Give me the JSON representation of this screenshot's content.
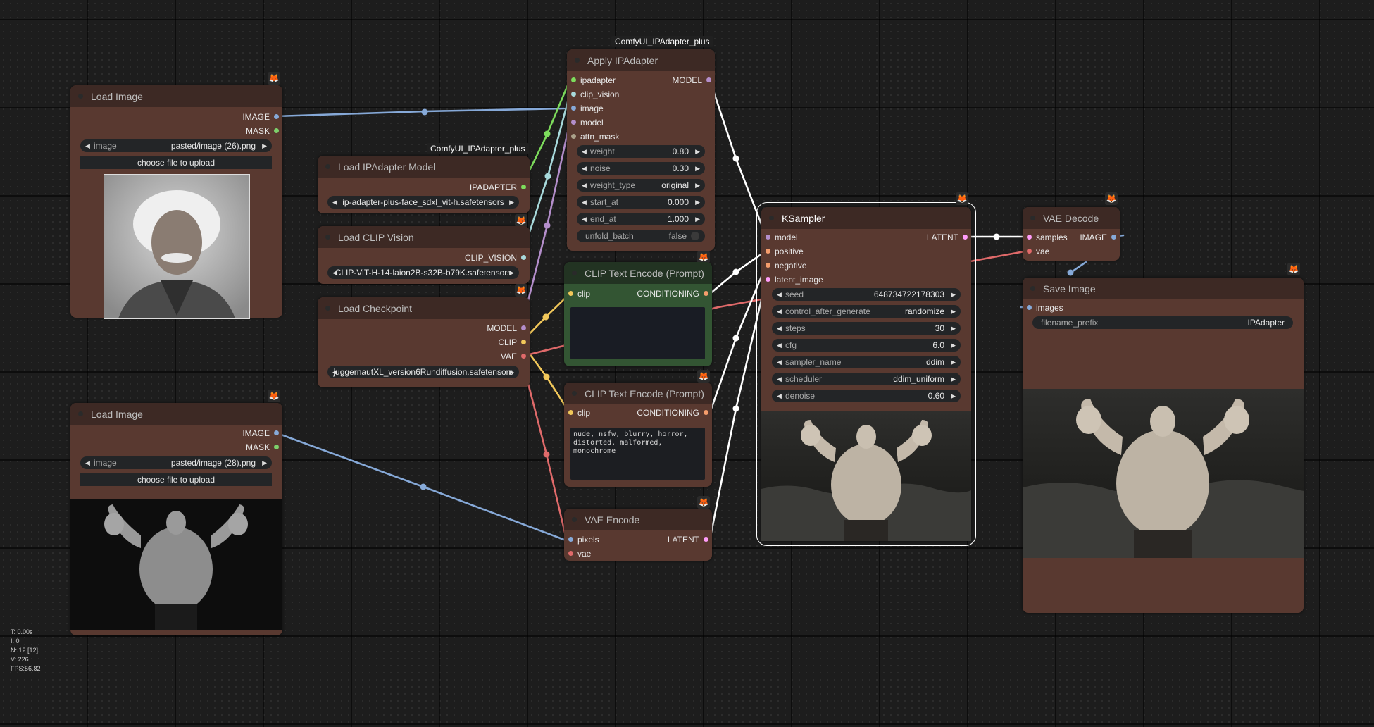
{
  "colors": {
    "model": "#b48ecb",
    "clip": "#f2c85a",
    "vae": "#e06a6a",
    "image": "#86a9d8",
    "mask": "#7dd06b",
    "latent": "#ff9cf9",
    "conditioning": "#f59d6c",
    "clip_vision": "#a8dadc",
    "ipadapter": "#7ddc5c",
    "white": "#ffffff"
  },
  "nodes": {
    "load_image_1": {
      "title": "Load Image",
      "outputs": [
        "IMAGE",
        "MASK"
      ],
      "widget_label": "image",
      "widget_value": "pasted/image (26).png",
      "button": "choose file to upload",
      "preview_alt": "portrait photo"
    },
    "load_image_2": {
      "title": "Load Image",
      "outputs": [
        "IMAGE",
        "MASK"
      ],
      "widget_label": "image",
      "widget_value": "pasted/image (28).png",
      "button": "choose file to upload",
      "preview_alt": "bodybuilder photo"
    },
    "ipadapter_model": {
      "title": "Load IPAdapter Model",
      "pack": "ComfyUI_IPAdapter_plus",
      "output": "IPADAPTER",
      "widget_value": "ip-adapter-plus-face_sdxl_vit-h.safetensors"
    },
    "clip_vision": {
      "title": "Load CLIP Vision",
      "output": "CLIP_VISION",
      "widget_value": "CLIP-ViT-H-14-laion2B-s32B-b79K.safetensors"
    },
    "checkpoint": {
      "title": "Load Checkpoint",
      "outputs": [
        "MODEL",
        "CLIP",
        "VAE"
      ],
      "widget_value": "juggernautXL_version6Rundiffusion.safetensors"
    },
    "apply_ipadapter": {
      "title": "Apply IPAdapter",
      "pack": "ComfyUI_IPAdapter_plus",
      "inputs": [
        "ipadapter",
        "clip_vision",
        "image",
        "model",
        "attn_mask"
      ],
      "output": "MODEL",
      "widgets": [
        {
          "label": "weight",
          "value": "0.80"
        },
        {
          "label": "noise",
          "value": "0.30"
        },
        {
          "label": "weight_type",
          "value": "original"
        },
        {
          "label": "start_at",
          "value": "0.000"
        },
        {
          "label": "end_at",
          "value": "1.000"
        }
      ],
      "toggle": {
        "label": "unfold_batch",
        "value": "false"
      }
    },
    "clip_text_pos": {
      "title": "CLIP Text Encode (Prompt)",
      "input": "clip",
      "output": "CONDITIONING",
      "text": ""
    },
    "clip_text_neg": {
      "title": "CLIP Text Encode (Prompt)",
      "input": "clip",
      "output": "CONDITIONING",
      "text": "nude, nsfw, blurry, horror,\ndistorted, malformed,\nmonochrome"
    },
    "vae_encode": {
      "title": "VAE Encode",
      "inputs": [
        "pixels",
        "vae"
      ],
      "output": "LATENT"
    },
    "ksampler": {
      "title": "KSampler",
      "inputs": [
        "model",
        "positive",
        "negative",
        "latent_image"
      ],
      "output": "LATENT",
      "widgets": [
        {
          "label": "seed",
          "value": "648734722178303"
        },
        {
          "label": "control_after_generate",
          "value": "randomize"
        },
        {
          "label": "steps",
          "value": "30"
        },
        {
          "label": "cfg",
          "value": "6.0"
        },
        {
          "label": "sampler_name",
          "value": "ddim"
        },
        {
          "label": "scheduler",
          "value": "ddim_uniform"
        },
        {
          "label": "denoise",
          "value": "0.60"
        }
      ]
    },
    "vae_decode": {
      "title": "VAE Decode",
      "inputs": [
        "samples",
        "vae"
      ],
      "output": "IMAGE"
    },
    "save_image": {
      "title": "Save Image",
      "input": "images",
      "widget_label": "filename_prefix",
      "widget_value": "IPAdapter"
    }
  },
  "badge_icon": "fox-icon",
  "stats": {
    "t": "T: 0.00s",
    "i": "I: 0",
    "n": "N: 12 [12]",
    "v": "V: 226",
    "fps": "FPS:56.82"
  }
}
